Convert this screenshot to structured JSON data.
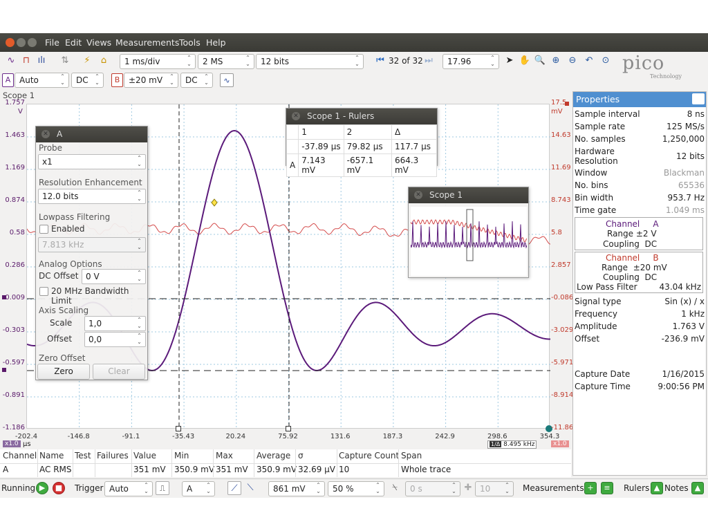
{
  "menu": [
    "File",
    "Edit",
    "Views",
    "Measurements",
    "Tools",
    "Help"
  ],
  "toolbar": {
    "timebase": "1 ms/div",
    "samples": "2 MS",
    "bits": "12 bits",
    "buffer": "32 of 32",
    "zoom": "17.96"
  },
  "channels": {
    "a_label": "A",
    "a_range": "Auto",
    "a_coupling": "DC",
    "b_label": "B",
    "b_range": "±20 mV",
    "b_coupling": "DC"
  },
  "brand": {
    "logo": "pico",
    "tag": "Technology"
  },
  "scope_title": "Scope 1",
  "axis": {
    "left_unit": "V",
    "right_unit": "mV",
    "left_ticks": [
      "1.757",
      "1.463",
      "1.169",
      "0.874",
      "0.58",
      "0.286",
      "-0.009",
      "-0.303",
      "-0.597",
      "-0.891",
      "-1.186"
    ],
    "right_ticks": [
      "17.5",
      "14.63",
      "11.69",
      "8.743",
      "5.8",
      "2.857",
      "-0.086",
      "-3.029",
      "-5.971",
      "-8.914",
      "-11.86"
    ],
    "x_ticks": [
      "-202.4",
      "-146.8",
      "-91.1",
      "-35.43",
      "20.24",
      "75.92",
      "131.6",
      "187.3",
      "242.9",
      "298.6",
      "354.3"
    ],
    "x_unit": "µs",
    "x_zoom_left": "x1.0",
    "x_zoom_right": "x1.0",
    "freq_box_label": "1/Δ",
    "freq_box": "8.495 kHz"
  },
  "panel_a": {
    "title": "A",
    "probe_label": "Probe",
    "probe": "x1",
    "res_label": "Resolution Enhancement",
    "res": "12.0 bits",
    "lp_label": "Lowpass Filtering",
    "lp_enabled": "Enabled",
    "lp_freq": "7.813 kHz",
    "analog_label": "Analog Options",
    "dc_offset_label": "DC Offset",
    "dc_offset": "0 V",
    "bw_limit": "20 MHz Bandwidth Limit",
    "axis_label": "Axis Scaling",
    "scale_label": "Scale",
    "scale": "1,0",
    "offset_label": "Offset",
    "offset": "0,0",
    "zero_label": "Zero Offset",
    "zero_btn": "Zero",
    "clear_btn": "Clear"
  },
  "rulers": {
    "title": "Scope 1 - Rulers",
    "headers": [
      "",
      "1",
      "2",
      "Δ"
    ],
    "rows": [
      [
        "",
        "-37.89 µs",
        "79.82 µs",
        "117.7 µs"
      ],
      [
        "A",
        "7.143 mV",
        "-657.1 mV",
        "664.3 mV"
      ]
    ]
  },
  "overview": {
    "title": "Scope 1"
  },
  "properties": {
    "title": "Properties",
    "rows1": [
      [
        "Sample interval",
        "8 ns"
      ],
      [
        "Sample rate",
        "125 MS/s"
      ],
      [
        "No. samples",
        "1,250,000"
      ],
      [
        "Hardware Resolution",
        "12 bits"
      ],
      [
        "Window",
        "Blackman"
      ],
      [
        "No. bins",
        "65536"
      ],
      [
        "Bin width",
        "953.7 Hz"
      ],
      [
        "Time gate",
        "1.049 ms"
      ]
    ],
    "chA": {
      "channel": "Channel",
      "name": "A",
      "range_label": "Range",
      "range": "±2 V",
      "coupling_label": "Coupling",
      "coupling": "DC"
    },
    "chB": {
      "channel": "Channel",
      "name": "B",
      "range_label": "Range",
      "range": "±20 mV",
      "coupling_label": "Coupling",
      "coupling": "DC",
      "lpf_label": "Low Pass Filter",
      "lpf": "43.04 kHz"
    },
    "rows2": [
      [
        "Signal type",
        "Sin (x) / x"
      ],
      [
        "Frequency",
        "1 kHz"
      ],
      [
        "Amplitude",
        "1.763 V"
      ],
      [
        "Offset",
        "-236.9 mV"
      ]
    ],
    "capture_date_label": "Capture Date",
    "capture_date": "1/16/2015",
    "capture_time_label": "Capture Time",
    "capture_time": "9:00:56 PM"
  },
  "measurements": {
    "headers": [
      "Channel",
      "Name",
      "Test",
      "Failures",
      "Value",
      "Min",
      "Max",
      "Average",
      "σ",
      "Capture Count",
      "Span"
    ],
    "row": [
      "A",
      "AC RMS",
      "",
      "",
      "351 mV",
      "350.9 mV",
      "351 mV",
      "350.9 mV",
      "32.69 µV",
      "10",
      "Whole trace"
    ]
  },
  "bottom": {
    "running": "Running",
    "trigger_label": "Trigger",
    "trigger_mode": "Auto",
    "trigger_channel": "A",
    "trigger_level": "861 mV",
    "pretrigger": "50 %",
    "delay": "0 s",
    "count": "10",
    "measurements": "Measurements",
    "rulers": "Rulers",
    "notes": "Notes"
  },
  "colors": {
    "channel_a": "#5b1a7a",
    "channel_b": "#d03a3a",
    "accent": "#4f8fd0"
  }
}
